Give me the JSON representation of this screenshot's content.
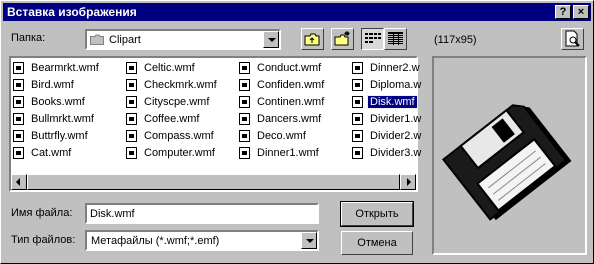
{
  "window": {
    "title": "Вставка изображения"
  },
  "titlebar": {
    "help_label": "?",
    "close_label": "×"
  },
  "folder": {
    "label": "Папка:",
    "value": "Clipart"
  },
  "preview": {
    "size": "(117x95)"
  },
  "files": {
    "columns": [
      [
        "Bearmrkt.wmf",
        "Bird.wmf",
        "Books.wmf",
        "Bullmrkt.wmf",
        "Buttrfly.wmf",
        "Cat.wmf"
      ],
      [
        "Celtic.wmf",
        "Checkmrk.wmf",
        "Cityscpe.wmf",
        "Coffee.wmf",
        "Compass.wmf",
        "Computer.wmf"
      ],
      [
        "Conduct.wmf",
        "Confiden.wmf",
        "Continen.wmf",
        "Dancers.wmf",
        "Deco.wmf",
        "Dinner1.wmf"
      ],
      [
        "Dinner2.w",
        "Diploma.w",
        "Disk.wmf",
        "Divider1.w",
        "Divider2.w",
        "Divider3.w"
      ]
    ],
    "selected": "Disk.wmf"
  },
  "filename": {
    "label": "Имя файла:",
    "value": "Disk.wmf"
  },
  "filetype": {
    "label": "Тип файлов:",
    "value": "Метафайлы (*.wmf;*.emf)"
  },
  "buttons": {
    "open": "Открыть",
    "cancel": "Отмена"
  }
}
